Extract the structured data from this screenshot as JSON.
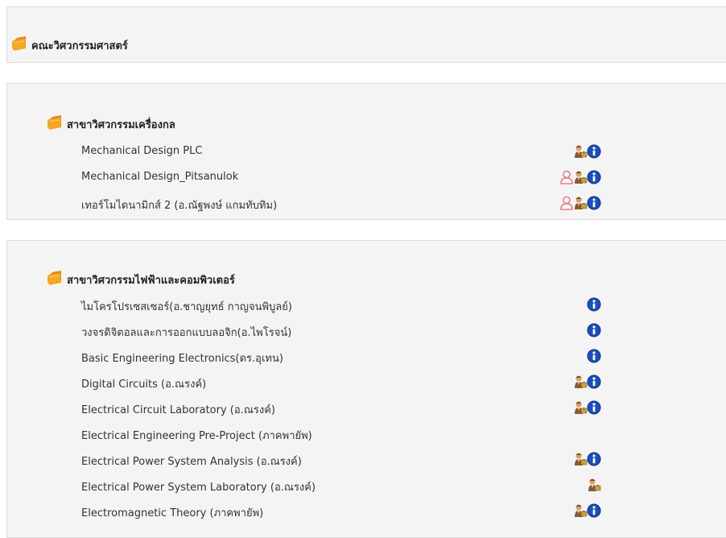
{
  "faculty": {
    "title": "คณะวิศวกรรมศาสตร์"
  },
  "categories": [
    {
      "title": "สาขาวิศวกรรมเครื่องกล",
      "courses": [
        {
          "name": "Mechanical Design PLC",
          "icons": [
            "teacher-icon",
            "info-icon"
          ]
        },
        {
          "name": "Mechanical Design_Pitsanulok",
          "icons": [
            "guest-icon",
            "teacher-icon",
            "info-icon"
          ]
        },
        {
          "name": "เทอร์โมไดนามิกส์ 2 (อ.ณัฐพงษ์ แกมทับทิม)",
          "icons": [
            "guest-icon",
            "teacher-icon",
            "info-icon"
          ]
        }
      ]
    },
    {
      "title": "สาขาวิศวกรรมไฟฟ้าและคอมพิวเตอร์",
      "courses": [
        {
          "name": "ไมโครโปรเซสเซอร์(อ.ชาญยุทธ์ กาญจนพิบูลย์)",
          "icons": [
            "info-icon"
          ]
        },
        {
          "name": "วงจรดิจิตอลและการออกแบบลอจิก(อ.ไพโรจน์)",
          "icons": [
            "info-icon"
          ]
        },
        {
          "name": "Basic Engineering Electronics(ดร.อุเทน)",
          "icons": [
            "info-icon"
          ]
        },
        {
          "name": "Digital Circuits (อ.ณรงค์)",
          "icons": [
            "teacher-icon",
            "info-icon"
          ]
        },
        {
          "name": "Electrical Circuit Laboratory (อ.ณรงค์)",
          "icons": [
            "teacher-icon",
            "info-icon"
          ]
        },
        {
          "name": "Electrical Engineering Pre-Project (ภาคพายัพ)",
          "icons": []
        },
        {
          "name": "Electrical Power System Analysis (อ.ณรงค์)",
          "icons": [
            "teacher-icon",
            "info-icon"
          ]
        },
        {
          "name": "Electrical Power System Laboratory (อ.ณรงค์)",
          "icons": [
            "teacher-icon"
          ]
        },
        {
          "name": "Electromagnetic Theory (ภาคพายัพ)",
          "icons": [
            "teacher-icon",
            "info-icon"
          ]
        }
      ]
    }
  ],
  "colors": {
    "panel_bg": "#f4f4f4",
    "panel_border": "#dcdcdc",
    "folder": "#f0a020",
    "info": "#1a4fbf",
    "guest": "#e8788a"
  }
}
